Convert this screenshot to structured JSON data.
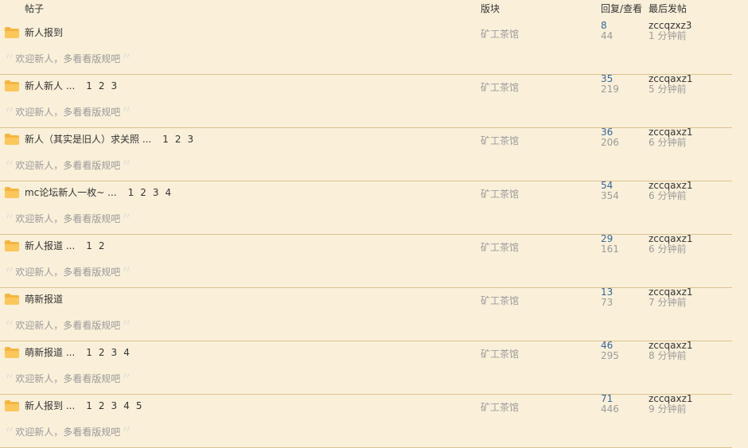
{
  "header": {
    "title": "帖子",
    "forum": "版块",
    "stats": "回复/查看",
    "last_post": "最后发帖"
  },
  "threads": [
    {
      "title": "新人报到",
      "pages": [],
      "forum": "矿工茶馆",
      "replies": "8",
      "views": "44",
      "last_user": "zccqzxz3",
      "last_time": "1 分钟前",
      "quote": "欢迎新人，多看看版规吧"
    },
    {
      "title": "新人新人 ...",
      "pages": [
        "1",
        "2",
        "3"
      ],
      "forum": "矿工茶馆",
      "replies": "35",
      "views": "219",
      "last_user": "zccqaxz1",
      "last_time": "5 分钟前",
      "quote": "欢迎新人，多看看版规吧"
    },
    {
      "title": "新人（其实是旧人）求关照 ...",
      "pages": [
        "1",
        "2",
        "3"
      ],
      "forum": "矿工茶馆",
      "replies": "36",
      "views": "206",
      "last_user": "zccqaxz1",
      "last_time": "6 分钟前",
      "quote": "欢迎新人，多看看版规吧"
    },
    {
      "title": "mc论坛新人一枚~ ...",
      "pages": [
        "1",
        "2",
        "3",
        "4"
      ],
      "forum": "矿工茶馆",
      "replies": "54",
      "views": "354",
      "last_user": "zccqaxz1",
      "last_time": "6 分钟前",
      "quote": "欢迎新人，多看看版规吧"
    },
    {
      "title": "新人报道 ...",
      "pages": [
        "1",
        "2"
      ],
      "forum": "矿工茶馆",
      "replies": "29",
      "views": "161",
      "last_user": "zccqaxz1",
      "last_time": "6 分钟前",
      "quote": "欢迎新人，多看看版规吧"
    },
    {
      "title": "萌新报道",
      "pages": [],
      "forum": "矿工茶馆",
      "replies": "13",
      "views": "73",
      "last_user": "zccqaxz1",
      "last_time": "7 分钟前",
      "quote": "欢迎新人，多看看版规吧"
    },
    {
      "title": "萌新报道 ...",
      "pages": [
        "1",
        "2",
        "3",
        "4"
      ],
      "forum": "矿工茶馆",
      "replies": "46",
      "views": "295",
      "last_user": "zccqaxz1",
      "last_time": "8 分钟前",
      "quote": "欢迎新人，多看看版规吧"
    },
    {
      "title": "新人报到 ...",
      "pages": [
        "1",
        "2",
        "3",
        "4",
        "5"
      ],
      "forum": "矿工茶馆",
      "replies": "71",
      "views": "446",
      "last_user": "zccqaxz1",
      "last_time": "9 分钟前",
      "quote": "欢迎新人，多看看版规吧"
    }
  ],
  "colors": {
    "background": "#faf0da",
    "divider": "#dcc08c",
    "replies": "#336699",
    "muted": "#9a9a9a",
    "folder": "#f5b53d"
  },
  "icons": {
    "thread": "folder-icon",
    "quote_open": "quote-open-icon",
    "quote_close": "quote-close-icon"
  }
}
